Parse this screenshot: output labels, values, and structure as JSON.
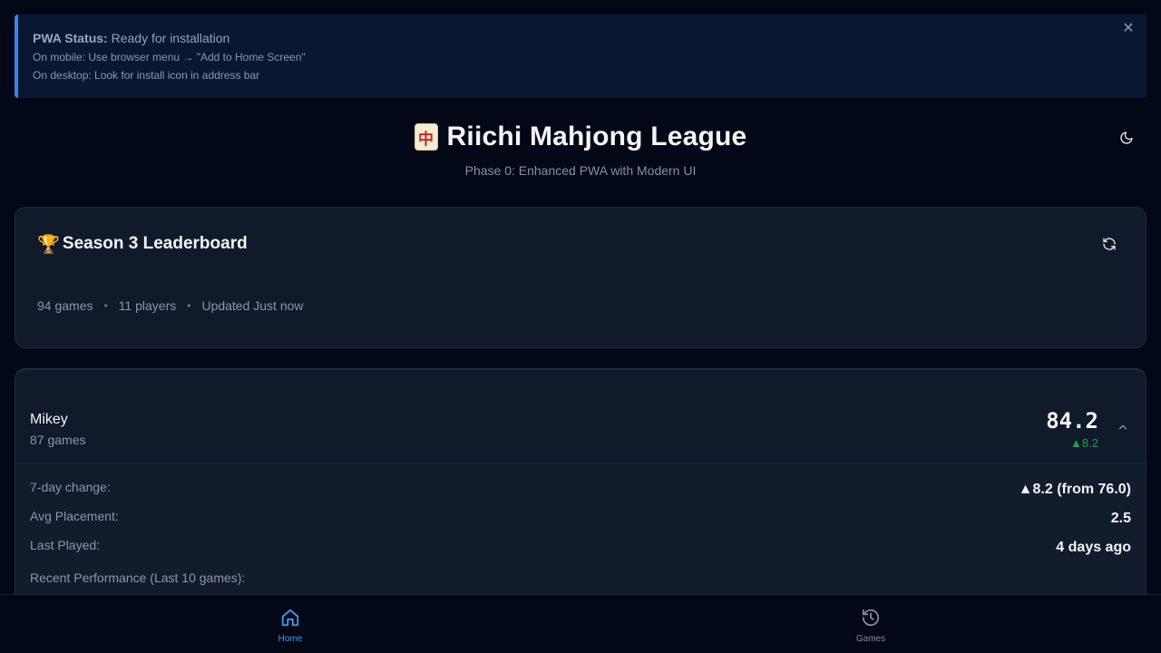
{
  "pwa_banner": {
    "status_label": "PWA Status:",
    "status_value": "Ready for installation",
    "mobile_hint": "On mobile: Use browser menu → \"Add to Home Screen\"",
    "desktop_hint": "On desktop: Look for install icon in address bar",
    "close_glyph": "✕",
    "accent_color": "#3b82f6"
  },
  "header": {
    "tile_glyph": "中",
    "title": "Riichi Mahjong League",
    "subtitle": "Phase 0: Enhanced PWA with Modern UI",
    "theme_icon": "moon-icon"
  },
  "leaderboard": {
    "trophy_glyph": "🏆",
    "title": "Season 3 Leaderboard",
    "refresh_icon": "refresh-icon",
    "stats": {
      "games": "94 games",
      "separator": "•",
      "players": "11 players",
      "updated": "Updated Just now"
    }
  },
  "player": {
    "name": "Mikey",
    "games": "87 games",
    "rating": "84.2",
    "delta": "▲8.2",
    "delta_color": "#22a04a",
    "expanded": true,
    "details": [
      {
        "label": "7-day change:",
        "value": "▲8.2 (from 76.0)"
      },
      {
        "label": "Avg Placement:",
        "value": "2.5"
      },
      {
        "label": "Last Played:",
        "value": "4 days ago"
      }
    ],
    "recent_label": "Recent Performance (Last 10 games):"
  },
  "bottom_nav": {
    "items": [
      {
        "label": "Home",
        "icon": "home-icon",
        "active": true
      },
      {
        "label": "Games",
        "icon": "history-icon",
        "active": false
      }
    ],
    "active_color": "#3b9bf0",
    "inactive_color": "#7f8aa0"
  }
}
